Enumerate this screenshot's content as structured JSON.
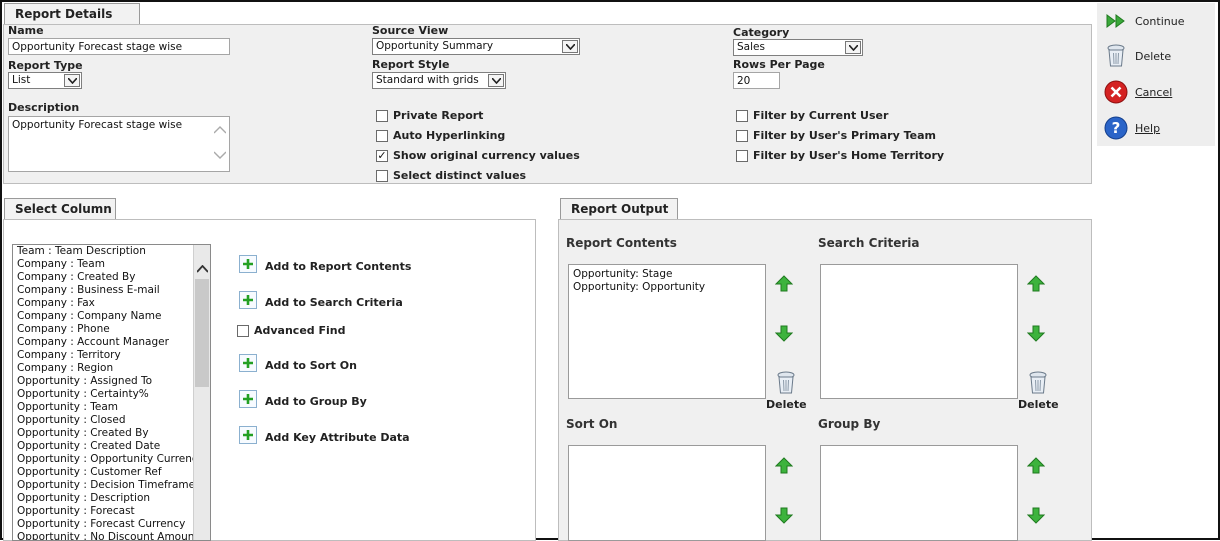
{
  "report_details": {
    "tab": "Report Details",
    "name_label": "Name",
    "name_value": "Opportunity Forecast stage wise",
    "type_label": "Report Type",
    "type_value": "List",
    "description_label": "Description",
    "description_value": "Opportunity Forecast stage wise",
    "source_view_label": "Source View",
    "source_view_value": "Opportunity Summary",
    "style_label": "Report Style",
    "style_value": "Standard with grids",
    "category_label": "Category",
    "category_value": "Sales",
    "rows_label": "Rows Per Page",
    "rows_value": "20",
    "options": [
      {
        "label": "Private Report",
        "checked": false
      },
      {
        "label": "Auto Hyperlinking",
        "checked": false
      },
      {
        "label": "Show original currency values",
        "checked": true
      },
      {
        "label": "Select distinct values",
        "checked": false
      }
    ],
    "filters": [
      {
        "label": "Filter by Current User",
        "checked": false
      },
      {
        "label": "Filter by User's Primary Team",
        "checked": false
      },
      {
        "label": "Filter by User's Home Territory",
        "checked": false
      }
    ]
  },
  "sidebar": {
    "continue": "Continue",
    "delete": "Delete",
    "cancel": "Cancel",
    "help": "Help"
  },
  "select_column": {
    "tab": "Select Column",
    "items": [
      "Team : Team Description",
      "Company : Team",
      "Company : Created By",
      "Company : Business E-mail",
      "Company : Fax",
      "Company : Company Name",
      "Company : Phone",
      "Company : Account Manager",
      "Company : Territory",
      "Company : Region",
      "Opportunity : Assigned To",
      "Opportunity : Certainty%",
      "Opportunity : Team",
      "Opportunity : Closed",
      "Opportunity : Created By",
      "Opportunity : Created Date",
      "Opportunity : Opportunity Currency",
      "Opportunity : Customer Ref",
      "Opportunity : Decision Timeframe",
      "Opportunity : Description",
      "Opportunity : Forecast",
      "Opportunity : Forecast Currency",
      "Opportunity : No Discount Amount"
    ],
    "add_report_contents": "Add to Report Contents",
    "add_search_criteria": "Add to Search Criteria",
    "advanced_find": "Advanced Find",
    "add_sort_on": "Add to Sort On",
    "add_group_by": "Add to Group By",
    "add_key_attribute": "Add Key Attribute Data"
  },
  "report_output": {
    "tab": "Report Output",
    "contents_label": "Report Contents",
    "contents_items": [
      "Opportunity: Stage",
      "Opportunity: Opportunity"
    ],
    "search_label": "Search Criteria",
    "sort_label": "Sort On",
    "group_label": "Group By",
    "delete_label": "Delete"
  },
  "colors": {
    "panel_bg": "#f0f0f0",
    "green_arrow": "#2fa52f",
    "cancel_red": "#d42222",
    "help_blue": "#2a64c8"
  }
}
